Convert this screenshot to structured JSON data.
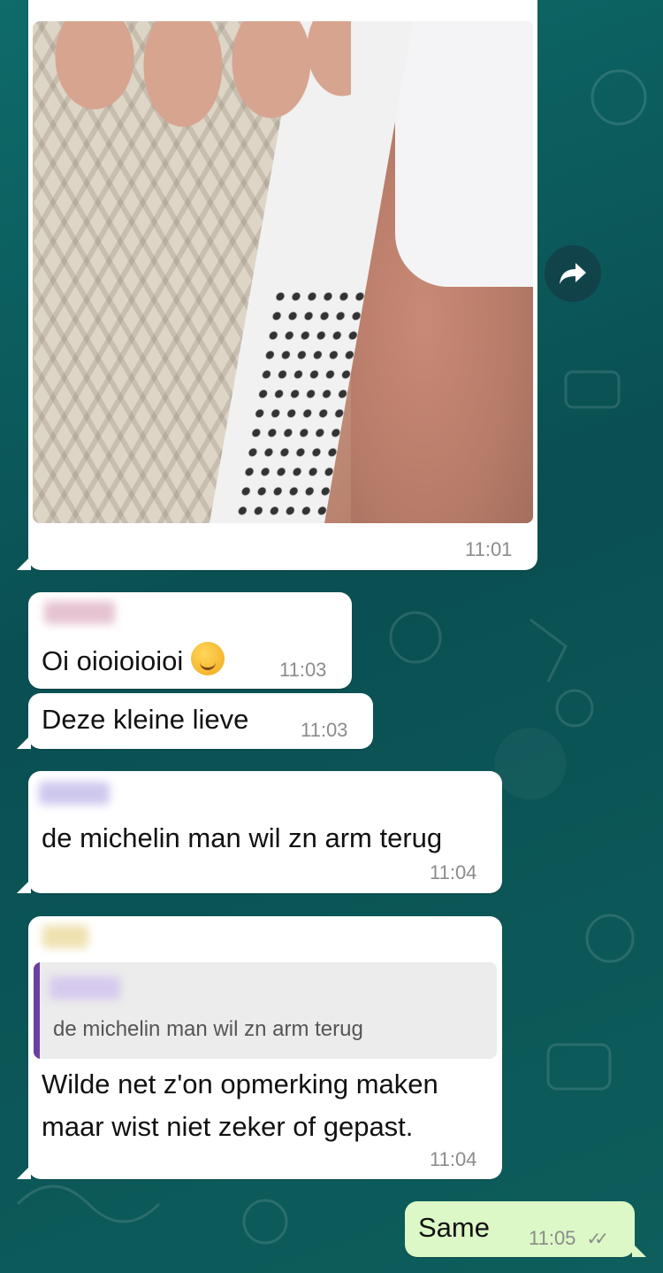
{
  "messages": {
    "photo_msg": {
      "time": "11:01"
    },
    "msg1": {
      "text": "Oi oioioioioi",
      "time": "11:03"
    },
    "msg2": {
      "text": "Deze kleine lieve",
      "time": "11:03"
    },
    "msg3": {
      "text": "de michelin man wil zn arm terug",
      "time": "11:04"
    },
    "msg4": {
      "quote_text": "de michelin man wil zn arm terug",
      "line1": "Wilde net z'on opmerking maken",
      "line2": "maar wist niet zeker of gepast.",
      "time": "11:04"
    },
    "msg5": {
      "text": "Same",
      "time": "11:05",
      "status": "double-check-read"
    }
  },
  "colors": {
    "incoming_bubble": "#ffffff",
    "outgoing_bubble": "#dcf8c6",
    "quote_accent": "#6d3f9c"
  },
  "icons": {
    "forward": "forward-arrow-icon",
    "read_receipt": "double-check-icon",
    "emoji": "drooling-face-emoji"
  }
}
